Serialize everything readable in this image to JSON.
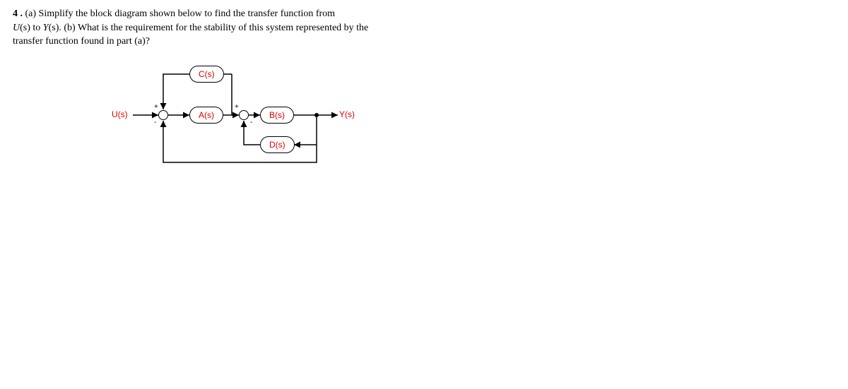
{
  "question": {
    "number": "4 .",
    "part_a_prefix": "(a) Simplify the block diagram shown below to find the transfer function from",
    "line2_prefix": "U",
    "line2_mid": "(s) to ",
    "line2_y": "Y",
    "line2_after": "(s). (b) What is the requirement for the stability of this system represented by the",
    "line3": "transfer function found in part (a)?"
  },
  "diagram": {
    "input": "U(s)",
    "output": "Y(s)",
    "blocks": {
      "A": "A(s)",
      "B": "B(s)",
      "C": "C(s)",
      "D": "D(s)"
    },
    "signs": {
      "sum1_top": "+",
      "sum1_bottom": "-",
      "sum2_top": "+",
      "sum2_bottom": "-"
    }
  }
}
